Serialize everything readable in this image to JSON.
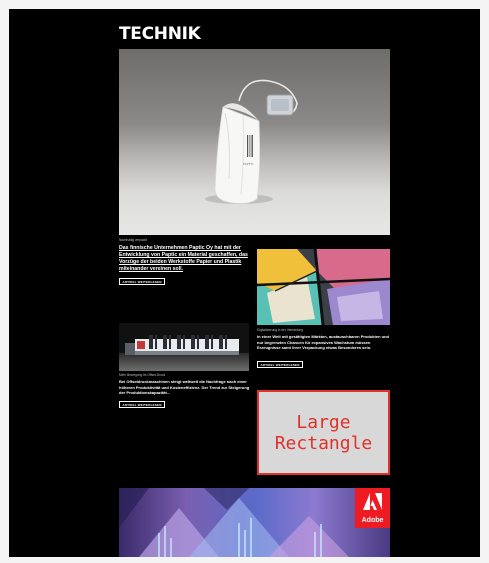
{
  "section": {
    "title": "TECHNIK"
  },
  "hero": {
    "caption": "Nachhaltig verpackt",
    "headline": "Das finnische Unternehmen Paptic Oy hat mit der Entwicklung von Paptic ein Material geschaffen, das Vorzüge der beiden Werkstoffe Papier und Plastik miteinander vereinen soll.",
    "button": "ARTIKEL WEITERLESEN"
  },
  "tile_right": {
    "caption": "Digitalisierung in der Veredelung",
    "text": "In einer Welt mit gesättigten Märkten, austauschbaren Produkten und nur begrenzten Chancen für expansives Wachstum müssen Erzeugnisse samt ihrer Verpackung etwas Besonderes sein.",
    "button": "ARTIKEL WEITERLESEN"
  },
  "tile_left": {
    "caption": "Mehr Bewegung im Offset-Druck",
    "text": "Bei Offsetdruckmaschinen steigt weltweit die Nachfrage nach einer höheren Produktivität und Kosteneffizienz. Der Trend zur Steigerung der Produktionskapazität...",
    "button": "ARTIKEL WEITERLESEN"
  },
  "ad_rectangle": {
    "label": "Large Rectangle"
  },
  "banner": {
    "brand": "Adobe"
  },
  "colors": {
    "page_bg": "#000000",
    "accent": "#e0312c",
    "adobe_red": "#ee1b23"
  }
}
